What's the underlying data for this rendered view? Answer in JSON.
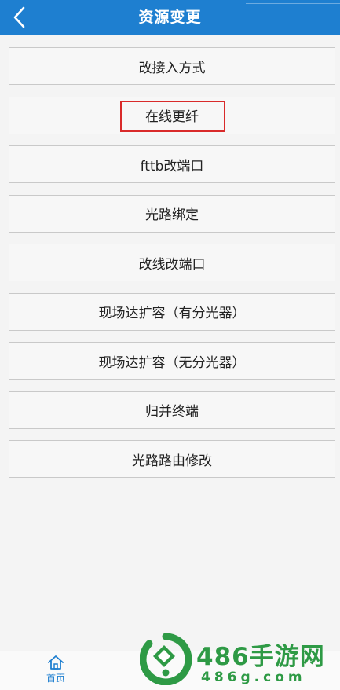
{
  "header": {
    "title": "资源变更",
    "color": "#1e7fd0"
  },
  "menu": {
    "items": [
      {
        "label": "改接入方式"
      },
      {
        "label": "在线更纤"
      },
      {
        "label": "fttb改端口"
      },
      {
        "label": "光路绑定"
      },
      {
        "label": "改线改端口"
      },
      {
        "label": "现场达扩容（有分光器）"
      },
      {
        "label": "现场达扩容（无分光器）"
      },
      {
        "label": "归并终端"
      },
      {
        "label": "光路路由修改"
      }
    ],
    "highlight_color": "#d92a2a"
  },
  "bottom_nav": {
    "home_label": "首页",
    "home_icon": "home-icon"
  },
  "watermark": {
    "brand": "486手游网",
    "url": "486g.com",
    "color": "#2e9a45"
  }
}
